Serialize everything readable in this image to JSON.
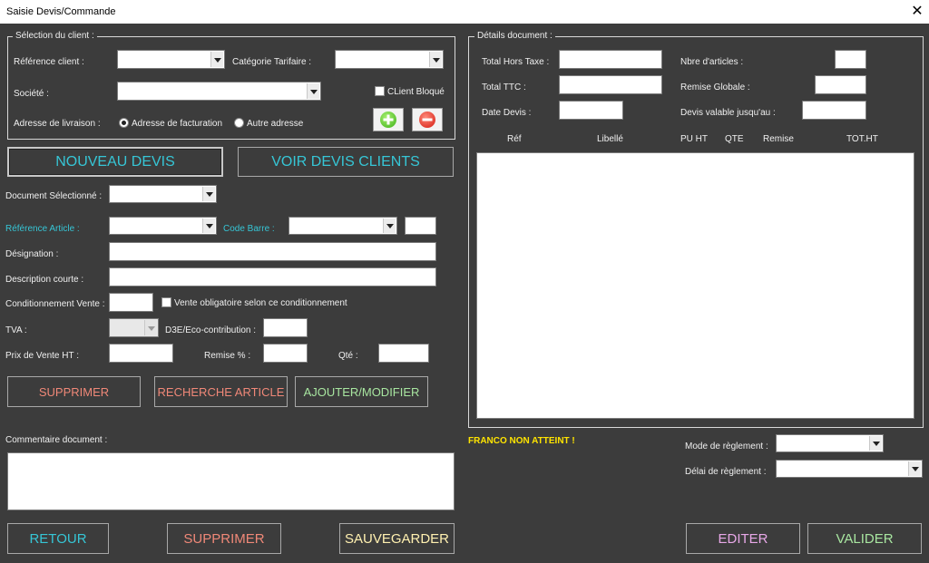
{
  "window": {
    "title": "Saisie Devis/Commande",
    "close_icon": "✕"
  },
  "client_section": {
    "legend": "Sélection du client :",
    "ref_client_label": "Référence client :",
    "categorie_label": "Catégorie Tarifaire :",
    "societe_label": "Société :",
    "client_bloque_label": "CLient Bloqué",
    "adresse_label": "Adresse de livraison :",
    "radio_facturation": "Adresse de facturation",
    "radio_autre": "Autre adresse"
  },
  "buttons": {
    "nouveau_devis": "NOUVEAU DEVIS",
    "voir_devis": "VOIR DEVIS CLIENTS",
    "supprimer_article": "SUPPRIMER",
    "recherche_article": "RECHERCHE ARTICLE",
    "ajouter_modifier": "AJOUTER/MODIFIER",
    "retour": "RETOUR",
    "supprimer_doc": "SUPPRIMER",
    "sauvegarder": "SAUVEGARDER",
    "editer": "EDITER",
    "valider": "VALIDER"
  },
  "article": {
    "doc_selectionne_label": "Document Sélectionné :",
    "ref_article_label": "Référence Article :",
    "code_barre_label": "Code Barre :",
    "designation_label": "Désignation :",
    "description_label": "Description courte :",
    "conditionnement_label": "Conditionnement Vente :",
    "vente_obligatoire_label": "Vente obligatoire selon ce conditionnement",
    "tva_label": "TVA :",
    "d3e_label": "D3E/Eco-contribution :",
    "prix_label": "Prix de Vente HT :",
    "remise_label": "Remise % :",
    "qte_label": "Qté :"
  },
  "commentaire_label": "Commentaire document :",
  "details": {
    "legend": "Détails document :",
    "total_ht_label": "Total Hors Taxe :",
    "total_ttc_label": "Total TTC :",
    "date_devis_label": "Date Devis :",
    "nbre_articles_label": "Nbre d'articles :",
    "remise_globale_label": "Remise Globale :",
    "devis_valable_label": "Devis valable jusqu'au :",
    "columns": [
      "Réf",
      "Libellé",
      "PU HT",
      "QTE",
      "Remise",
      "TOT.HT"
    ]
  },
  "franco_message": "FRANCO NON ATTEINT !",
  "reglement": {
    "mode_label": "Mode de règlement :",
    "delai_label": "Délai de règlement :"
  },
  "colors": {
    "background": "#3c3c3c",
    "cyan": "#36c6d6",
    "salmon": "#f08878",
    "green": "#a8e6a0",
    "yellow": "#ffe400",
    "pink": "#e8a8e8"
  }
}
